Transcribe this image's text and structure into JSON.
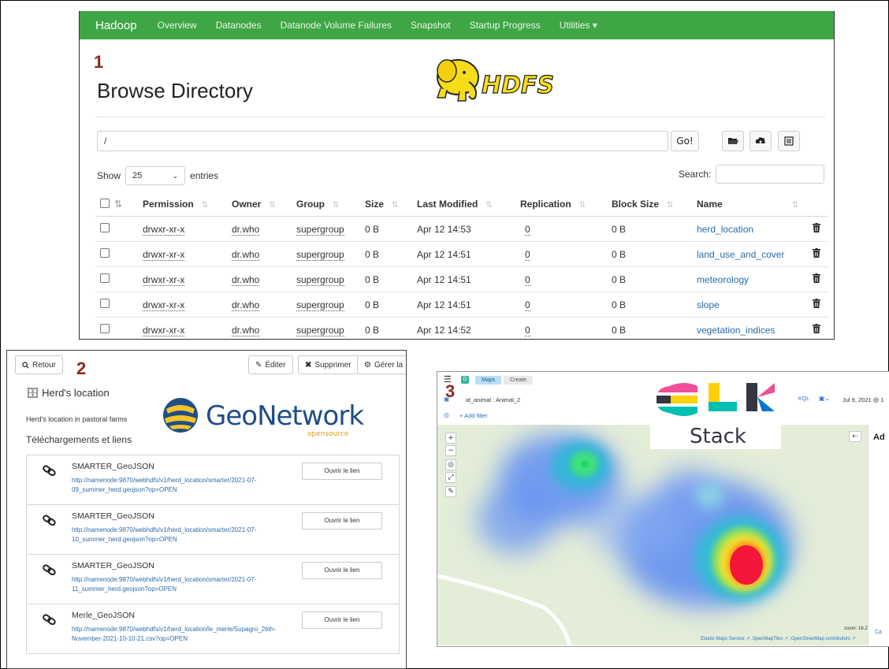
{
  "labels": {
    "panel1": "1",
    "panel2": "2",
    "panel3": "3"
  },
  "hadoop": {
    "nav": {
      "brand": "Hadoop",
      "items": [
        "Overview",
        "Datanodes",
        "Datanode Volume Failures",
        "Snapshot",
        "Startup Progress",
        "Utilities ▾"
      ]
    },
    "title": "Browse Directory",
    "logo_text": "HDFS",
    "path_value": "/",
    "go_label": "Go!",
    "show_label": "Show",
    "entries_value": "25",
    "entries_label": "entries",
    "search_label": "Search:",
    "columns": [
      "Permission",
      "Owner",
      "Group",
      "Size",
      "Last Modified",
      "Replication",
      "Block Size",
      "Name"
    ],
    "rows": [
      {
        "permission": "drwxr-xr-x",
        "owner": "dr.who",
        "group": "supergroup",
        "size": "0 B",
        "modified": "Apr 12 14:53",
        "replication": "0",
        "block": "0 B",
        "name": "herd_location"
      },
      {
        "permission": "drwxr-xr-x",
        "owner": "dr.who",
        "group": "supergroup",
        "size": "0 B",
        "modified": "Apr 12 14:51",
        "replication": "0",
        "block": "0 B",
        "name": "land_use_and_cover"
      },
      {
        "permission": "drwxr-xr-x",
        "owner": "dr.who",
        "group": "supergroup",
        "size": "0 B",
        "modified": "Apr 12 14:51",
        "replication": "0",
        "block": "0 B",
        "name": "meteorology"
      },
      {
        "permission": "drwxr-xr-x",
        "owner": "dr.who",
        "group": "supergroup",
        "size": "0 B",
        "modified": "Apr 12 14:51",
        "replication": "0",
        "block": "0 B",
        "name": "slope"
      },
      {
        "permission": "drwxr-xr-x",
        "owner": "dr.who",
        "group": "supergroup",
        "size": "0 B",
        "modified": "Apr 12 14:52",
        "replication": "0",
        "block": "0 B",
        "name": "vegetation_indices"
      }
    ]
  },
  "geonetwork": {
    "back_label": "Retour",
    "edit_label": "Éditer",
    "delete_label": "Supprimer",
    "manage_label": "Gérer la",
    "record_title": "Herd's location",
    "record_subtitle": "Herd's location in pastoral farms",
    "section_title": "Téléchargements et liens",
    "logo_text": "GeoNetwork",
    "logo_sub": "opensource",
    "links": [
      {
        "name": "SMARTER_GeoJSON",
        "url": "http://namenode:9870/webhdfs/v1/herd_location/smarter/2021-07-09_summer_herd.geojson?op=OPEN",
        "button": "Ouvrir le lien"
      },
      {
        "name": "SMARTER_GeoJSON",
        "url": "http://namenode:9870/webhdfs/v1/herd_location/smarter/2021-07-10_summer_herd.geojson?op=OPEN",
        "button": "Ouvrir le lien"
      },
      {
        "name": "SMARTER_GeoJSON",
        "url": "http://namenode:9870/webhdfs/v1/herd_location/smarter/2021-07-11_summer_herd.geojson?op=OPEN",
        "button": "Ouvrir le lien"
      },
      {
        "name": "Merle_GeoJSON",
        "url": "http://namenode:9870/webhdfs/v1/herd_location/le_merle/Supagro_26th-November-2021-10-10-21.csv?op=OPEN",
        "button": "Ouvrir le lien"
      }
    ]
  },
  "kibana": {
    "badge": "D",
    "breadcrumbs": [
      "Maps",
      "Create"
    ],
    "query": "id_animal : Animal_2",
    "kql": "KQL",
    "date": "Jul 9, 2021 @ 1",
    "add_filter": "+ Add filter",
    "elk_word": "Stack",
    "zoom_text": "zoom: 16.2",
    "attribution": "Elastic Maps Service ↗, OpenMapTiles ↗, OpenStreetMap contributors ↗",
    "side_label": "Ad",
    "side_bottom": "Ca"
  }
}
